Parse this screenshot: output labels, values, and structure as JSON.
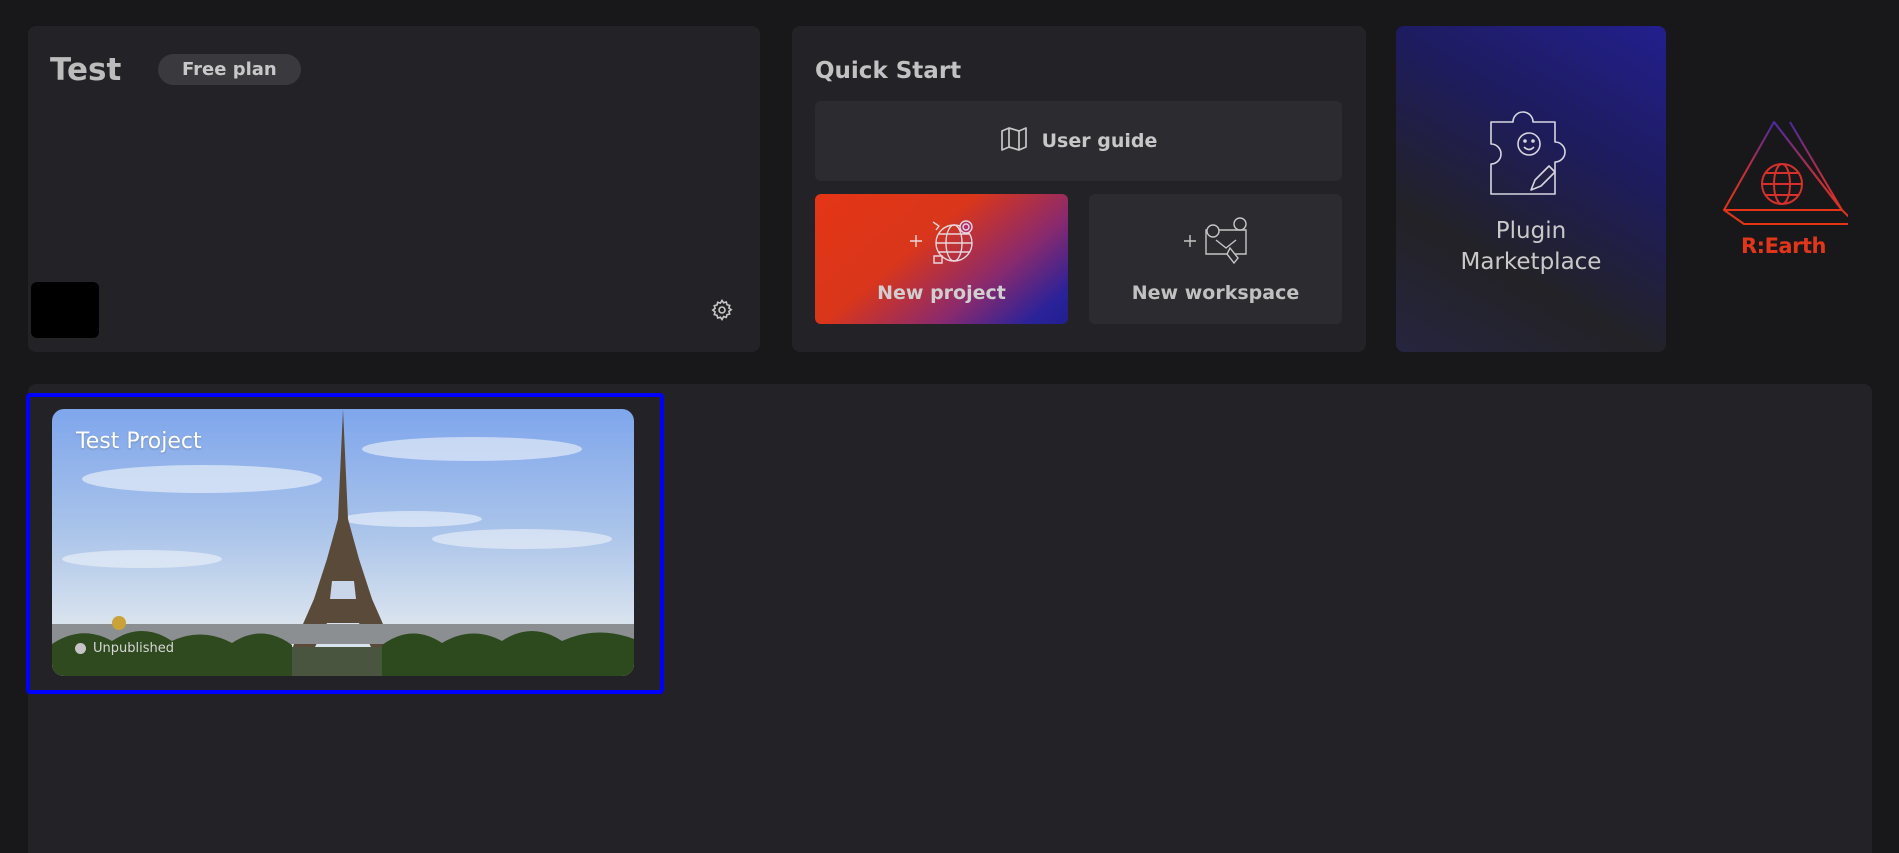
{
  "workspace": {
    "name": "Test",
    "plan": "Free plan",
    "settings_icon": "gear-icon"
  },
  "quick_start": {
    "title": "Quick Start",
    "user_guide": {
      "label": "User guide",
      "icon": "map-icon"
    },
    "new_project": {
      "label": "New project",
      "icon": "plus-globe-icon"
    },
    "new_workspace": {
      "label": "New workspace",
      "icon": "plus-workspace-icon"
    }
  },
  "plugin_marketplace": {
    "label_line1": "Plugin",
    "label_line2": "Marketplace",
    "icon": "puzzle-icon"
  },
  "logo": {
    "text": "R:Earth"
  },
  "projects": [
    {
      "name": "Test Project",
      "status": "Unpublished",
      "thumbnail": "eiffel-tower-photo"
    }
  ],
  "colors": {
    "background": "#18181b",
    "panel": "#232226",
    "accent_red": "#e53516",
    "accent_blue": "#221f90",
    "selection_outline": "#0000ff"
  }
}
